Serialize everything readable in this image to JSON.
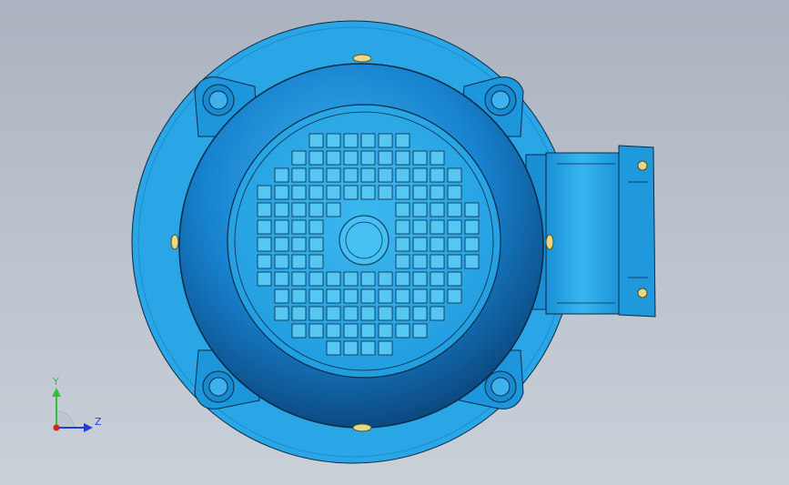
{
  "viewport": {
    "background_top": "#aab3bf",
    "background_bottom": "#c9d0d8"
  },
  "model": {
    "type": "electric-motor",
    "view": "rear view",
    "colors": {
      "flange": "#2aa6e6",
      "housing": "#1486d2",
      "housing_dark": "#0b4f8a",
      "fan_cover": "#2fb0ec",
      "grille_hole": "#56c6f3",
      "outline": "#0a2a44",
      "bolt": "#e8d98a",
      "terminal_box": "#24a9ea"
    }
  },
  "triad": {
    "y_label": "Y",
    "z_label": "Z",
    "y_color": "#2fbf3a",
    "z_color": "#1f3fd6",
    "x_color": "#d82222"
  }
}
